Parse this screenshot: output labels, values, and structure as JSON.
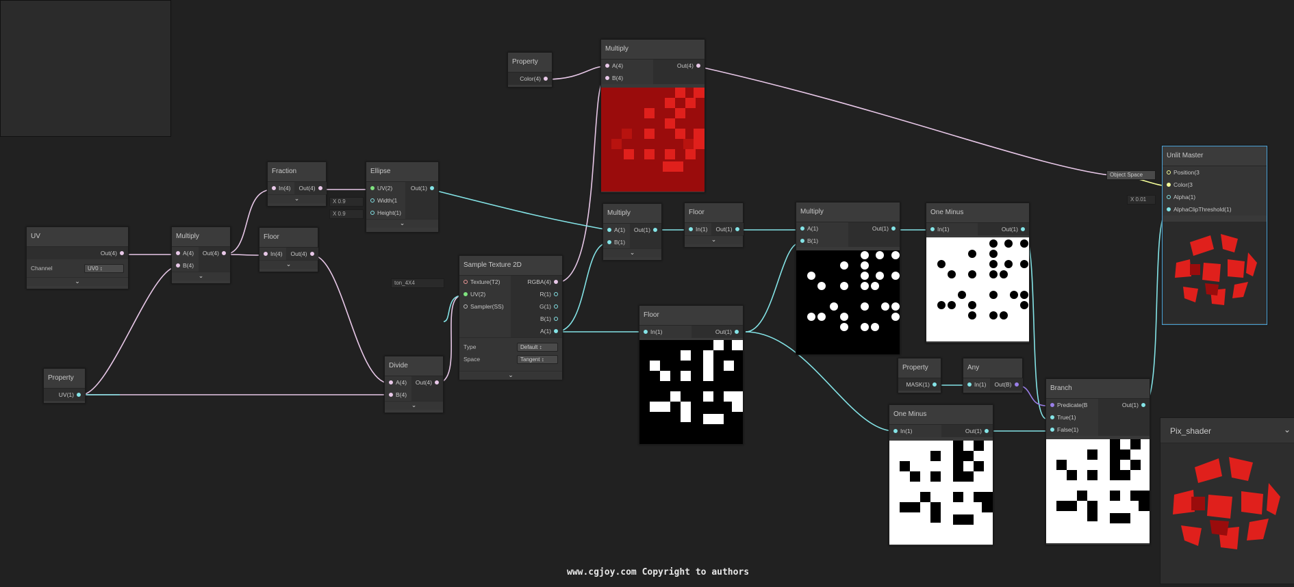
{
  "nodes": {
    "uv": {
      "title": "UV",
      "out": "Out(4)",
      "channel_label": "Channel",
      "channel_value": "UV0"
    },
    "property_uv": {
      "title": "Property",
      "out": "UV(1)"
    },
    "multiply1": {
      "title": "Multiply",
      "in_a": "A(4)",
      "in_b": "B(4)",
      "out": "Out(4)"
    },
    "fraction": {
      "title": "Fraction",
      "in": "In(4)",
      "out": "Out(4)"
    },
    "floor1": {
      "title": "Floor",
      "in": "In(4)",
      "out": "Out(4)"
    },
    "ellipse": {
      "title": "Ellipse",
      "in_uv": "UV(2)",
      "in_w": "Width(1",
      "in_h": "Height(1)",
      "out": "Out(1)",
      "width_value": "X  0.9",
      "height_value": "X  0.9"
    },
    "divide": {
      "title": "Divide",
      "in_a": "A(4)",
      "in_b": "B(4)",
      "out": "Out(4)"
    },
    "sample_texture": {
      "title": "Sample Texture 2D",
      "in_tex": "Texture(T2)",
      "in_uv": "UV(2)",
      "in_sampler": "Sampler(SS)",
      "out_rgba": "RGBA(4)",
      "out_r": "R(1)",
      "out_g": "G(1)",
      "out_b": "B(1)",
      "out_a": "A(1)",
      "type_label": "Type",
      "type_value": "Default",
      "space_label": "Space",
      "space_value": "Tangent",
      "texture_value": "ton_4X4"
    },
    "property_color": {
      "title": "Property",
      "out": "Color(4)"
    },
    "multiply_color": {
      "title": "Multiply",
      "in_a": "A(4)",
      "in_b": "B(4)",
      "out": "Out(4)"
    },
    "multiply2": {
      "title": "Multiply",
      "in_a": "A(1)",
      "in_b": "B(1)",
      "out": "Out(1)"
    },
    "floor2": {
      "title": "Floor",
      "in": "In(1)",
      "out": "Out(1)"
    },
    "floor3": {
      "title": "Floor",
      "in": "In(1)",
      "out": "Out(1)"
    },
    "multiply3": {
      "title": "Multiply",
      "in_a": "A(1)",
      "in_b": "B(1)",
      "out": "Out(1)"
    },
    "one_minus1": {
      "title": "One Minus",
      "in": "In(1)",
      "out": "Out(1)"
    },
    "one_minus2": {
      "title": "One Minus",
      "in": "In(1)",
      "out": "Out(1)"
    },
    "property_mask": {
      "title": "Property",
      "out": "MASK(1)"
    },
    "any": {
      "title": "Any",
      "in": "In(1)",
      "out": "Out(B)"
    },
    "branch": {
      "title": "Branch",
      "in_pred": "Predicate(B",
      "in_true": "True(1)",
      "in_false": "False(1)",
      "out": "Out(1)"
    },
    "unlit_master": {
      "title": "Unlit Master",
      "in_pos": "Position(3",
      "in_color": "Color(3",
      "in_alpha": "Alpha(1)",
      "in_clip": "AlphaClipThreshold(1)",
      "space_value": "Object Space",
      "alpha_value": "X  0.01"
    }
  },
  "pix_shader": {
    "title": "Pix_shader"
  },
  "copyright": "www.cgjoy.com Copyright to authors",
  "colors": {
    "wire_vec4": "#e8c8e8",
    "wire_vec1": "#84e4e7",
    "wire_vec3": "#f6ff9a",
    "wire_bool": "#9a7fe8",
    "canvas": "#212121",
    "red_preview": "#b00d0d"
  }
}
